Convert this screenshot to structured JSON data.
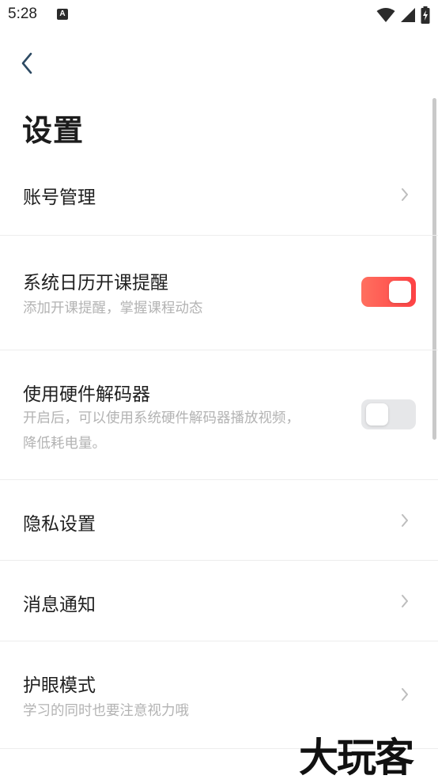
{
  "status_bar": {
    "time": "5:28",
    "app_icon_letter": "A",
    "icons": [
      "wifi-icon",
      "signal-icon",
      "battery-charging-icon"
    ]
  },
  "header": {
    "back_icon": "chevron-left-icon",
    "title": "设置"
  },
  "settings": {
    "account": {
      "label": "账号管理"
    },
    "calendar": {
      "label": "系统日历开课提醒",
      "desc": "添加开课提醒，掌握课程动态",
      "enabled": true
    },
    "decoder": {
      "label": "使用硬件解码器",
      "desc": "开启后，可以使用系统硬件解码器播放视频，降低耗电量。",
      "enabled": false
    },
    "privacy": {
      "label": "隐私设置"
    },
    "notifications": {
      "label": "消息通知"
    },
    "eye_care": {
      "label": "护眼模式",
      "desc": "学习的同时也要注意视力哦"
    }
  },
  "colors": {
    "toggle_on_start": "#ff6f5f",
    "toggle_on_end": "#ff4245",
    "toggle_off": "#e6e7e9",
    "back_icon": "#2d4a63"
  },
  "watermark": "大玩客"
}
